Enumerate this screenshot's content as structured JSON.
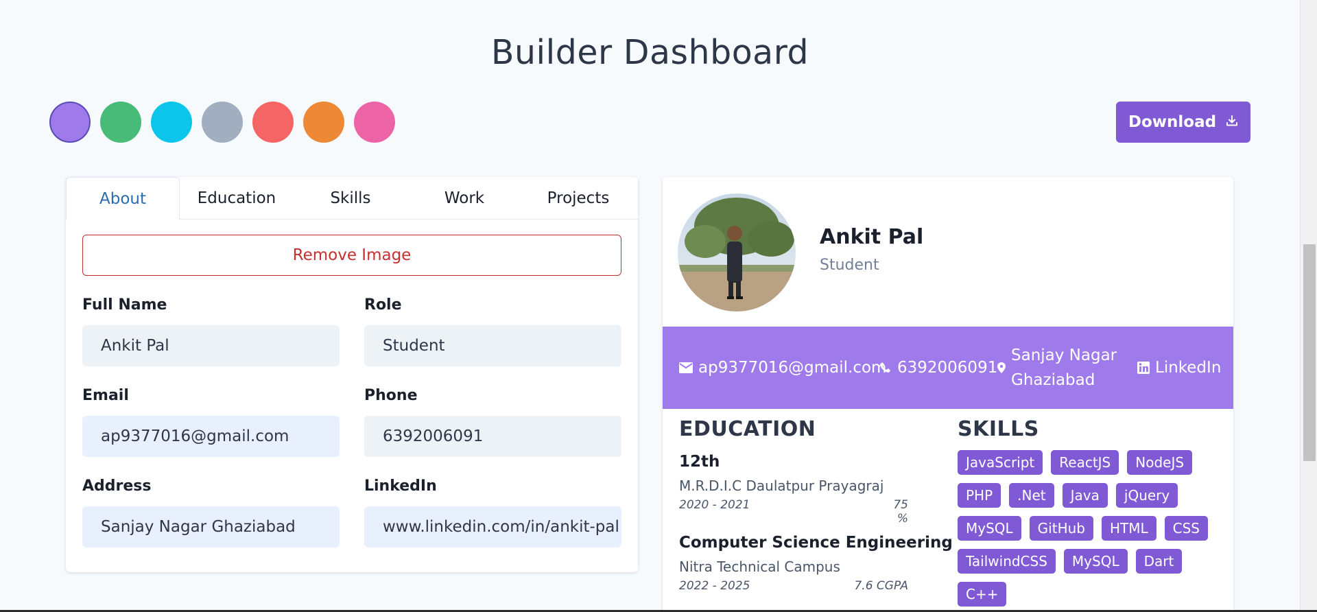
{
  "header": {
    "title": "Builder Dashboard"
  },
  "theme": {
    "swatches": [
      "#9f7aea",
      "#48bb78",
      "#0bc5ea",
      "#a0aec0",
      "#f56565",
      "#ed8936",
      "#ed64a6"
    ],
    "selected_index": 0
  },
  "toolbar": {
    "download_label": "Download"
  },
  "tabs": [
    {
      "label": "About"
    },
    {
      "label": "Education"
    },
    {
      "label": "Skills"
    },
    {
      "label": "Work"
    },
    {
      "label": "Projects"
    }
  ],
  "form": {
    "remove_image_label": "Remove Image",
    "full_name": {
      "label": "Full Name",
      "value": "Ankit Pal"
    },
    "role": {
      "label": "Role",
      "value": "Student"
    },
    "email": {
      "label": "Email",
      "value": "ap9377016@gmail.com"
    },
    "phone": {
      "label": "Phone",
      "value": "6392006091"
    },
    "address": {
      "label": "Address",
      "value": "Sanjay Nagar Ghaziabad"
    },
    "linkedin": {
      "label": "LinkedIn",
      "value": "www.linkedin.com/in/ankit-pal"
    }
  },
  "resume": {
    "name": "Ankit Pal",
    "role": "Student",
    "contact": {
      "email": "ap9377016@gmail.com",
      "phone": "6392006091",
      "address_line1": "Sanjay Nagar",
      "address_line2": "Ghaziabad",
      "linkedin": "LinkedIn"
    },
    "education_heading": "EDUCATION",
    "skills_heading": "SKILLS",
    "education": [
      {
        "degree": "12th",
        "school": "M.R.D.I.C Daulatpur Prayagraj",
        "years": "2020 - 2021",
        "score": "75 %"
      },
      {
        "degree": "Computer Science Engineering",
        "school": "Nitra Technical Campus",
        "years": "2022 - 2025",
        "score": "7.6 CGPA"
      }
    ],
    "skills": [
      "JavaScript",
      "ReactJS",
      "NodeJS",
      "PHP",
      ".Net",
      "Java",
      "jQuery",
      "MySQL",
      "GitHub",
      "HTML",
      "CSS",
      "TailwindCSS",
      "MySQL",
      "Dart",
      "C++"
    ]
  }
}
